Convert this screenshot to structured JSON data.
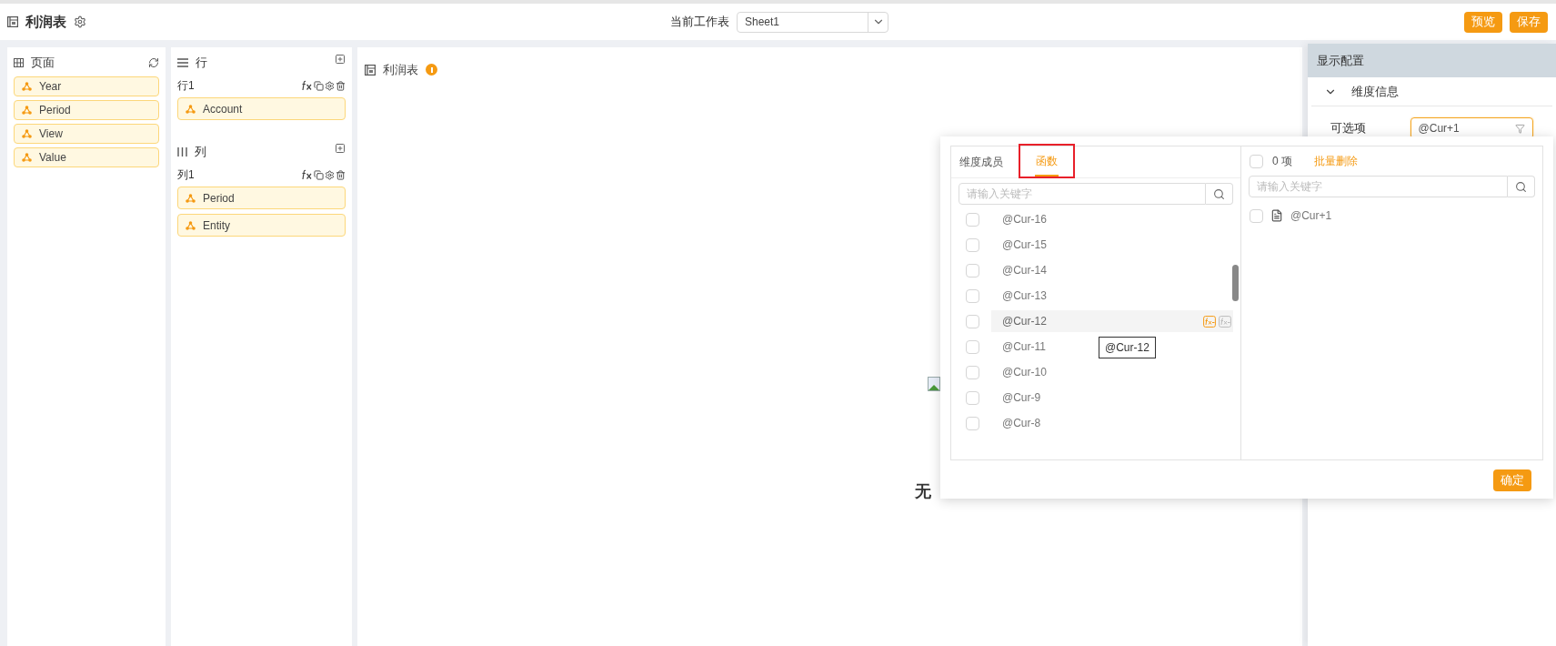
{
  "header": {
    "title": "利润表",
    "sheet_label": "当前工作表",
    "sheet_value": "Sheet1",
    "buttons": [
      "预览",
      "保存"
    ]
  },
  "page_panel": {
    "title": "页面",
    "items": [
      "Year",
      "Period",
      "View",
      "Value"
    ]
  },
  "axis_panel": {
    "sections": [
      {
        "kind": "rows",
        "title": "行",
        "groups": [
          {
            "label": "行1",
            "items": [
              "Account"
            ]
          }
        ]
      },
      {
        "kind": "columns",
        "title": "列",
        "groups": [
          {
            "label": "列1",
            "items": [
              "Period",
              "Entity"
            ]
          }
        ]
      }
    ]
  },
  "report": {
    "title": "利润表",
    "message": "无"
  },
  "display_config": {
    "title": "显示配置",
    "section": {
      "title": "维度信息",
      "expanded": true
    },
    "fields": [
      {
        "label": "可选项",
        "value": "@Cur+1"
      }
    ]
  },
  "picker": {
    "tabs": [
      {
        "label": "维度成员",
        "selected": false
      },
      {
        "label": "函数",
        "selected": true
      }
    ],
    "search_placeholder": "请输入关键字",
    "members": [
      {
        "name": "@Cur-16",
        "checked": false,
        "highlighted": false
      },
      {
        "name": "@Cur-15",
        "checked": false,
        "highlighted": false
      },
      {
        "name": "@Cur-14",
        "checked": false,
        "highlighted": false
      },
      {
        "name": "@Cur-13",
        "checked": false,
        "highlighted": false
      },
      {
        "name": "@Cur-12",
        "checked": false,
        "highlighted": true
      },
      {
        "name": "@Cur-11",
        "checked": false,
        "highlighted": false
      },
      {
        "name": "@Cur-10",
        "checked": false,
        "highlighted": false
      },
      {
        "name": "@Cur-9",
        "checked": false,
        "highlighted": false
      },
      {
        "name": "@Cur-8",
        "checked": false,
        "highlighted": false
      }
    ],
    "tooltip": "@Cur-12",
    "selection": {
      "all_checked": false,
      "count": "0 项",
      "action": "批量删除",
      "search_placeholder": "请输入关键字",
      "items": [
        {
          "name": "@Cur+1",
          "checked": false
        }
      ]
    },
    "confirm": "确定"
  }
}
